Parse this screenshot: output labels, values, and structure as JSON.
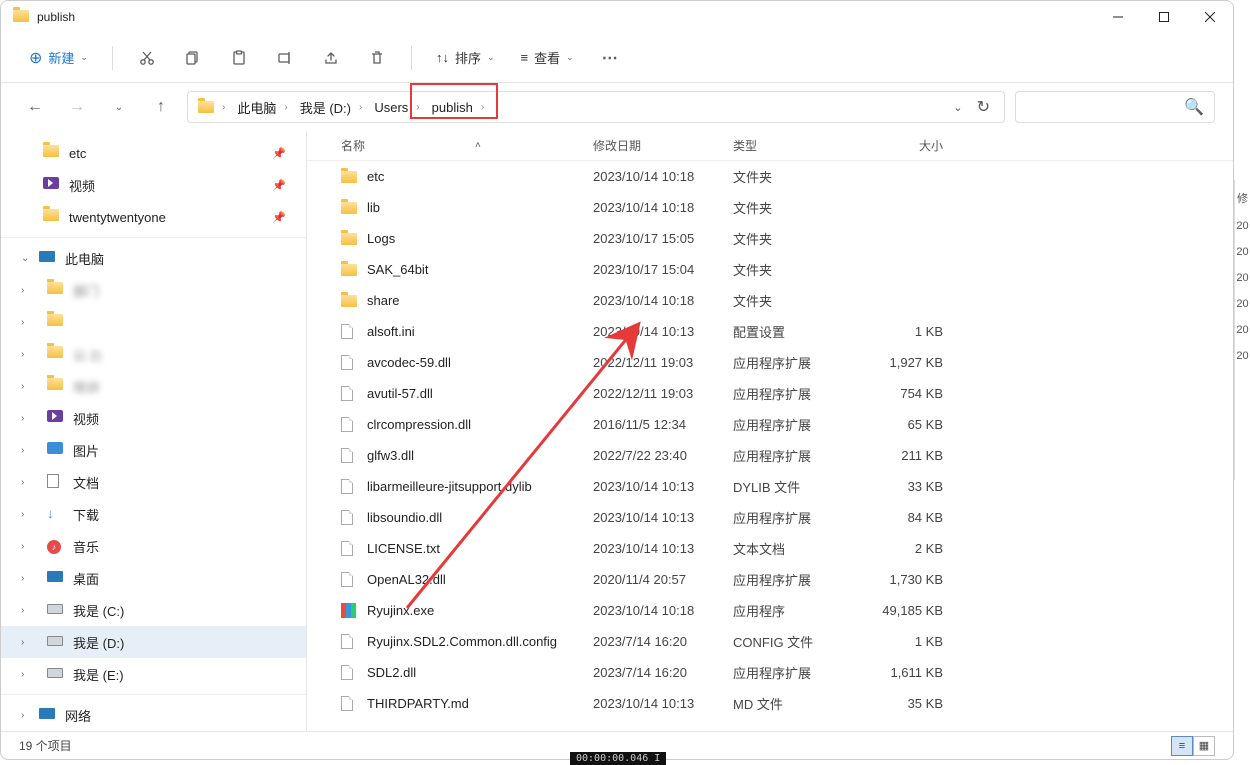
{
  "title": "publish",
  "toolbar": {
    "new_label": "新建",
    "sort_label": "排序",
    "view_label": "查看"
  },
  "breadcrumbs": [
    {
      "label": "此电脑"
    },
    {
      "label": "我是 (D:)"
    },
    {
      "label": "Users"
    },
    {
      "label": "publish"
    }
  ],
  "sidebar": {
    "quick": [
      {
        "label": "etc",
        "icon": "folder",
        "pinned": true
      },
      {
        "label": "视频",
        "icon": "video",
        "pinned": true
      },
      {
        "label": "twentytwentyone",
        "icon": "folder",
        "pinned": true
      }
    ],
    "thispc_label": "此电脑",
    "thispc_children": [
      {
        "label": "部门",
        "icon": "folder",
        "blur": true
      },
      {
        "label": " ",
        "icon": "folder",
        "blur": true
      },
      {
        "label": "公                                2)",
        "icon": "folder",
        "blur": true
      },
      {
        "label": "培训",
        "icon": "folder",
        "blur": true
      },
      {
        "label": "视频",
        "icon": "video"
      },
      {
        "label": "图片",
        "icon": "pictures"
      },
      {
        "label": "文档",
        "icon": "documents"
      },
      {
        "label": "下载",
        "icon": "downloads"
      },
      {
        "label": "音乐",
        "icon": "music"
      },
      {
        "label": "桌面",
        "icon": "desktop"
      },
      {
        "label": "我是 (C:)",
        "icon": "disk"
      },
      {
        "label": "我是 (D:)",
        "icon": "disk",
        "active": true
      },
      {
        "label": "我是 (E:)",
        "icon": "disk"
      }
    ],
    "network_label": "网络"
  },
  "columns": {
    "name": "名称",
    "date": "修改日期",
    "type": "类型",
    "size": "大小"
  },
  "files": [
    {
      "name": "etc",
      "date": "2023/10/14 10:18",
      "type": "文件夹",
      "size": "",
      "icon": "folder"
    },
    {
      "name": "lib",
      "date": "2023/10/14 10:18",
      "type": "文件夹",
      "size": "",
      "icon": "folder"
    },
    {
      "name": "Logs",
      "date": "2023/10/17 15:05",
      "type": "文件夹",
      "size": "",
      "icon": "folder"
    },
    {
      "name": "SAK_64bit",
      "date": "2023/10/17 15:04",
      "type": "文件夹",
      "size": "",
      "icon": "folder"
    },
    {
      "name": "share",
      "date": "2023/10/14 10:18",
      "type": "文件夹",
      "size": "",
      "icon": "folder"
    },
    {
      "name": "alsoft.ini",
      "date": "2023/10/14 10:13",
      "type": "配置设置",
      "size": "1 KB",
      "icon": "ini"
    },
    {
      "name": "avcodec-59.dll",
      "date": "2022/12/11 19:03",
      "type": "应用程序扩展",
      "size": "1,927 KB",
      "icon": "dll"
    },
    {
      "name": "avutil-57.dll",
      "date": "2022/12/11 19:03",
      "type": "应用程序扩展",
      "size": "754 KB",
      "icon": "dll"
    },
    {
      "name": "clrcompression.dll",
      "date": "2016/11/5 12:34",
      "type": "应用程序扩展",
      "size": "65 KB",
      "icon": "dll"
    },
    {
      "name": "glfw3.dll",
      "date": "2022/7/22 23:40",
      "type": "应用程序扩展",
      "size": "211 KB",
      "icon": "dll"
    },
    {
      "name": "libarmeilleure-jitsupport.dylib",
      "date": "2023/10/14 10:13",
      "type": "DYLIB 文件",
      "size": "33 KB",
      "icon": "file"
    },
    {
      "name": "libsoundio.dll",
      "date": "2023/10/14 10:13",
      "type": "应用程序扩展",
      "size": "84 KB",
      "icon": "dll"
    },
    {
      "name": "LICENSE.txt",
      "date": "2023/10/14 10:13",
      "type": "文本文档",
      "size": "2 KB",
      "icon": "txt"
    },
    {
      "name": "OpenAL32.dll",
      "date": "2020/11/4 20:57",
      "type": "应用程序扩展",
      "size": "1,730 KB",
      "icon": "dll"
    },
    {
      "name": "Ryujinx.exe",
      "date": "2023/10/14 10:18",
      "type": "应用程序",
      "size": "49,185 KB",
      "icon": "ryujinx"
    },
    {
      "name": "Ryujinx.SDL2.Common.dll.config",
      "date": "2023/7/14 16:20",
      "type": "CONFIG 文件",
      "size": "1 KB",
      "icon": "file"
    },
    {
      "name": "SDL2.dll",
      "date": "2023/7/14 16:20",
      "type": "应用程序扩展",
      "size": "1,611 KB",
      "icon": "dll"
    },
    {
      "name": "THIRDPARTY.md",
      "date": "2023/10/14 10:13",
      "type": "MD 文件",
      "size": "35 KB",
      "icon": "file"
    }
  ],
  "status": "19 个项目",
  "peek_items": [
    "修",
    "20",
    "20",
    "20",
    "20",
    "20",
    "20"
  ],
  "timecode": "00:00:00.046  I"
}
